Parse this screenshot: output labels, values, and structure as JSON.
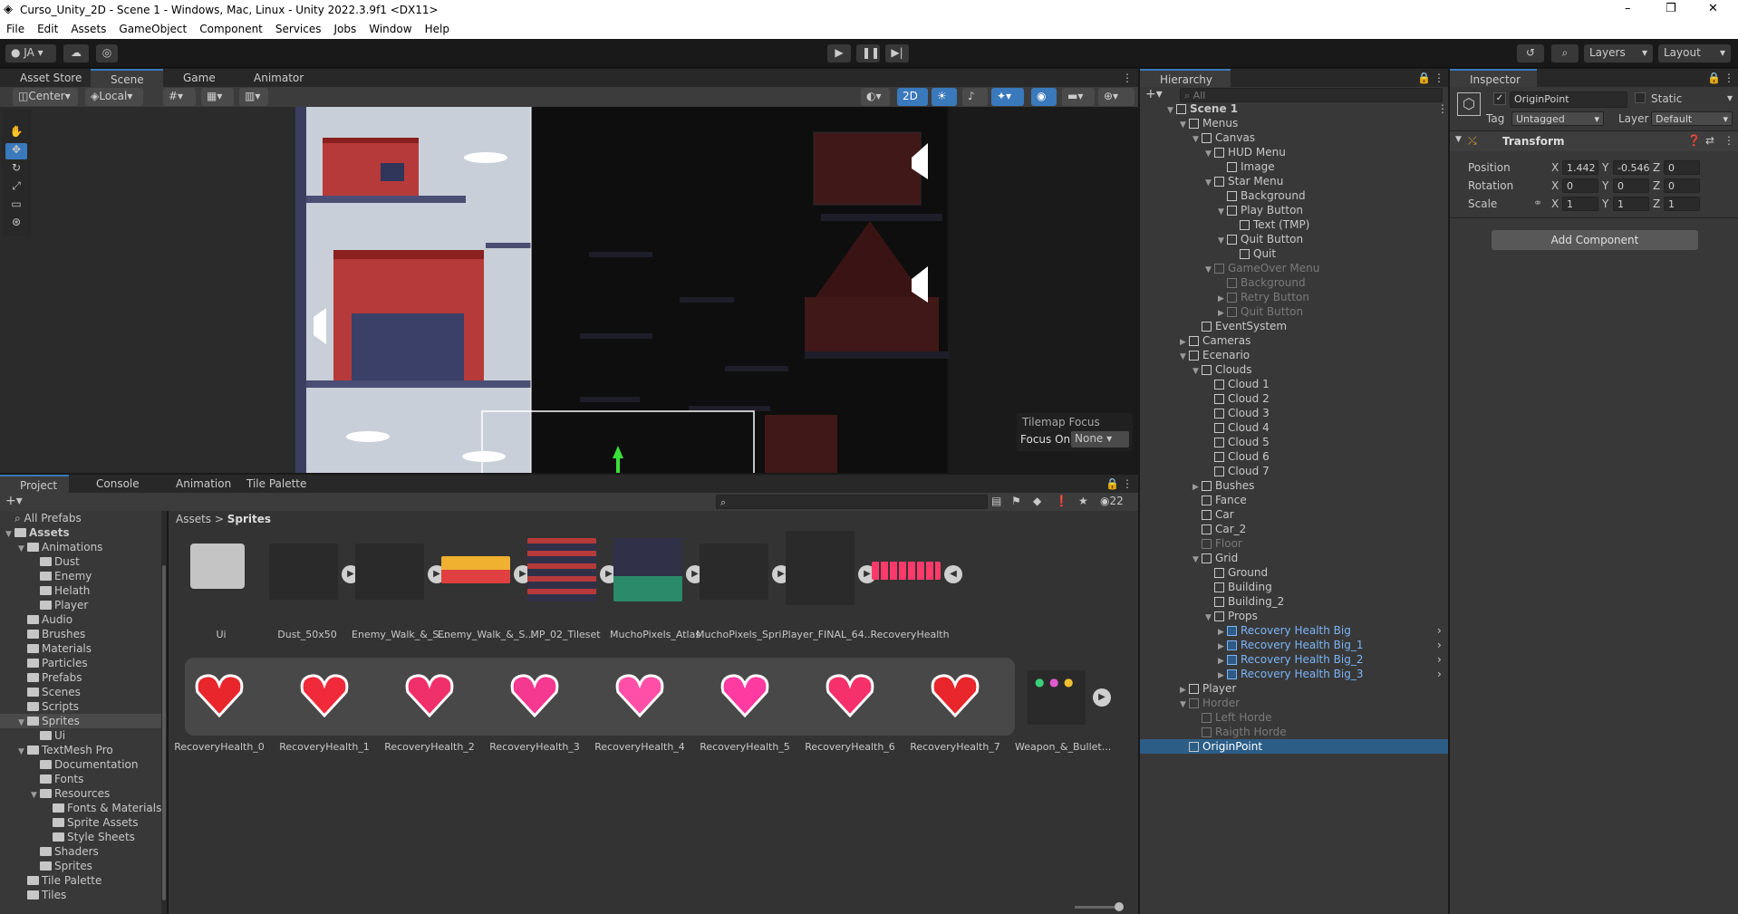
{
  "window": {
    "title": "Curso_Unity_2D - Scene 1 - Windows, Mac, Linux - Unity 2022.3.9f1 <DX11>",
    "min": "–",
    "max": "❐",
    "close": "✕"
  },
  "menu": [
    "File",
    "Edit",
    "Assets",
    "GameObject",
    "Component",
    "Services",
    "Jobs",
    "Window",
    "Help"
  ],
  "toolbar": {
    "account": "JA",
    "layers": "Layers",
    "layout": "Layout"
  },
  "scene_tabs": [
    "Asset Store",
    "Scene",
    "Game",
    "Animator"
  ],
  "scene_tools": {
    "pivot": "Center",
    "space": "Local",
    "mode2d": "2D"
  },
  "tilemap": {
    "title": "Tilemap Focus",
    "focus_label": "Focus On",
    "focus_value": "None"
  },
  "bottom_tabs": [
    "Project",
    "Console",
    "Animation",
    "Tile Palette"
  ],
  "project": {
    "search_placeholder": "",
    "hidden_count": "22",
    "breadcrumb": [
      "Assets",
      "Sprites"
    ],
    "tree": [
      {
        "label": "All Prefabs",
        "indent": 0,
        "kind": "search"
      },
      {
        "label": "Assets",
        "indent": 0,
        "kind": "folder",
        "open": true,
        "bold": true
      },
      {
        "label": "Animations",
        "indent": 1,
        "kind": "folder",
        "open": true
      },
      {
        "label": "Dust",
        "indent": 2,
        "kind": "folder"
      },
      {
        "label": "Enemy",
        "indent": 2,
        "kind": "folder"
      },
      {
        "label": "Helath",
        "indent": 2,
        "kind": "folder"
      },
      {
        "label": "Player",
        "indent": 2,
        "kind": "folder"
      },
      {
        "label": "Audio",
        "indent": 1,
        "kind": "folder"
      },
      {
        "label": "Brushes",
        "indent": 1,
        "kind": "folder"
      },
      {
        "label": "Materials",
        "indent": 1,
        "kind": "folder"
      },
      {
        "label": "Particles",
        "indent": 1,
        "kind": "folder"
      },
      {
        "label": "Prefabs",
        "indent": 1,
        "kind": "folder"
      },
      {
        "label": "Scenes",
        "indent": 1,
        "kind": "folder"
      },
      {
        "label": "Scripts",
        "indent": 1,
        "kind": "folder"
      },
      {
        "label": "Sprites",
        "indent": 1,
        "kind": "folder",
        "open": true,
        "selected": true
      },
      {
        "label": "Ui",
        "indent": 2,
        "kind": "folder"
      },
      {
        "label": "TextMesh Pro",
        "indent": 1,
        "kind": "folder",
        "open": true
      },
      {
        "label": "Documentation",
        "indent": 2,
        "kind": "folder"
      },
      {
        "label": "Fonts",
        "indent": 2,
        "kind": "folder"
      },
      {
        "label": "Resources",
        "indent": 2,
        "kind": "folder",
        "open": true
      },
      {
        "label": "Fonts & Materials",
        "indent": 3,
        "kind": "folder"
      },
      {
        "label": "Sprite Assets",
        "indent": 3,
        "kind": "folder"
      },
      {
        "label": "Style Sheets",
        "indent": 3,
        "kind": "folder"
      },
      {
        "label": "Shaders",
        "indent": 2,
        "kind": "folder"
      },
      {
        "label": "Sprites",
        "indent": 2,
        "kind": "folder"
      },
      {
        "label": "Tile Palette",
        "indent": 1,
        "kind": "folder"
      },
      {
        "label": "Tiles",
        "indent": 1,
        "kind": "folder"
      }
    ],
    "assets_row1": [
      "Ui",
      "Dust_50x50",
      "Enemy_Walk_&_S...",
      "Enemy_Walk_&_S...",
      "MP_02_Tileset",
      "MuchoPixels_Atlas",
      "MuchoPixels_Spri...",
      "Player_FINAL_64...",
      "RecoveryHealth"
    ],
    "assets_row2": [
      "RecoveryHealth_0",
      "RecoveryHealth_1",
      "RecoveryHealth_2",
      "RecoveryHealth_3",
      "RecoveryHealth_4",
      "RecoveryHealth_5",
      "RecoveryHealth_6",
      "RecoveryHealth_7",
      "Weapon_&_Bullet..."
    ]
  },
  "hierarchy": {
    "title": "Hierarchy",
    "search": "All",
    "rows": [
      {
        "label": "Scene 1",
        "indent": 0,
        "kind": "scene",
        "tri": "▼"
      },
      {
        "label": "Menus",
        "indent": 1,
        "kind": "obj",
        "tri": "▼"
      },
      {
        "label": "Canvas",
        "indent": 2,
        "kind": "obj",
        "tri": "▼"
      },
      {
        "label": "HUD Menu",
        "indent": 3,
        "kind": "obj",
        "tri": "▼"
      },
      {
        "label": "Image",
        "indent": 4,
        "kind": "obj"
      },
      {
        "label": "Star Menu",
        "indent": 3,
        "kind": "obj",
        "tri": "▼"
      },
      {
        "label": "Background",
        "indent": 4,
        "kind": "obj"
      },
      {
        "label": "Play Button",
        "indent": 4,
        "kind": "obj",
        "tri": "▼"
      },
      {
        "label": "Text (TMP)",
        "indent": 5,
        "kind": "obj"
      },
      {
        "label": "Quit Button",
        "indent": 4,
        "kind": "obj",
        "tri": "▼"
      },
      {
        "label": "Quit",
        "indent": 5,
        "kind": "obj"
      },
      {
        "label": "GameOver Menu",
        "indent": 3,
        "kind": "dim",
        "tri": "▼"
      },
      {
        "label": "Background",
        "indent": 4,
        "kind": "dim"
      },
      {
        "label": "Retry Button",
        "indent": 4,
        "kind": "dim",
        "tri": "▶"
      },
      {
        "label": "Quit Button",
        "indent": 4,
        "kind": "dim",
        "tri": "▶"
      },
      {
        "label": "EventSystem",
        "indent": 2,
        "kind": "obj"
      },
      {
        "label": "Cameras",
        "indent": 1,
        "kind": "obj",
        "tri": "▶"
      },
      {
        "label": "Ecenario",
        "indent": 1,
        "kind": "obj",
        "tri": "▼"
      },
      {
        "label": "Clouds",
        "indent": 2,
        "kind": "obj",
        "tri": "▼"
      },
      {
        "label": "Cloud 1",
        "indent": 3,
        "kind": "obj"
      },
      {
        "label": "Cloud 2",
        "indent": 3,
        "kind": "obj"
      },
      {
        "label": "Cloud 3",
        "indent": 3,
        "kind": "obj"
      },
      {
        "label": "Cloud 4",
        "indent": 3,
        "kind": "obj"
      },
      {
        "label": "Cloud 5",
        "indent": 3,
        "kind": "obj"
      },
      {
        "label": "Cloud 6",
        "indent": 3,
        "kind": "obj"
      },
      {
        "label": "Cloud 7",
        "indent": 3,
        "kind": "obj"
      },
      {
        "label": "Bushes",
        "indent": 2,
        "kind": "obj",
        "tri": "▶"
      },
      {
        "label": "Fance",
        "indent": 2,
        "kind": "obj"
      },
      {
        "label": "Car",
        "indent": 2,
        "kind": "obj"
      },
      {
        "label": "Car_2",
        "indent": 2,
        "kind": "obj"
      },
      {
        "label": "Floor",
        "indent": 2,
        "kind": "dim"
      },
      {
        "label": "Grid",
        "indent": 2,
        "kind": "obj",
        "tri": "▼"
      },
      {
        "label": "Ground",
        "indent": 3,
        "kind": "obj"
      },
      {
        "label": "Building",
        "indent": 3,
        "kind": "obj"
      },
      {
        "label": "Building_2",
        "indent": 3,
        "kind": "obj"
      },
      {
        "label": "Props",
        "indent": 3,
        "kind": "obj",
        "tri": "▼"
      },
      {
        "label": "Recovery Health Big",
        "indent": 4,
        "kind": "prefab",
        "tri": "▶"
      },
      {
        "label": "Recovery Health Big_1",
        "indent": 4,
        "kind": "prefab",
        "tri": "▶"
      },
      {
        "label": "Recovery Health Big_2",
        "indent": 4,
        "kind": "prefab",
        "tri": "▶"
      },
      {
        "label": "Recovery Health Big_3",
        "indent": 4,
        "kind": "prefab",
        "tri": "▶"
      },
      {
        "label": "Player",
        "indent": 1,
        "kind": "obj",
        "tri": "▶"
      },
      {
        "label": "Horder",
        "indent": 1,
        "kind": "dim",
        "tri": "▼"
      },
      {
        "label": "Left Horde",
        "indent": 2,
        "kind": "dim"
      },
      {
        "label": "Raigth Horde",
        "indent": 2,
        "kind": "dim"
      },
      {
        "label": "OriginPoint",
        "indent": 1,
        "kind": "obj",
        "selected": true
      }
    ]
  },
  "inspector": {
    "title": "Inspector",
    "name": "OriginPoint",
    "static": "Static",
    "tag_label": "Tag",
    "tag": "Untagged",
    "layer_label": "Layer",
    "layer": "Default",
    "component": "Transform",
    "position_label": "Position",
    "pos": {
      "x": "1.442",
      "y": "-0.546",
      "z": "0"
    },
    "rotation_label": "Rotation",
    "rot": {
      "x": "0",
      "y": "0",
      "z": "0"
    },
    "scale_label": "Scale",
    "scale": {
      "x": "1",
      "y": "1",
      "z": "1"
    },
    "add_component": "Add Component"
  },
  "colors": {
    "accent": "#3a79bb",
    "selection": "#2c5d87",
    "prefab": "#7bb4f7",
    "heart_red": "#e8262b",
    "heart_pink": "#ff4fa6"
  }
}
